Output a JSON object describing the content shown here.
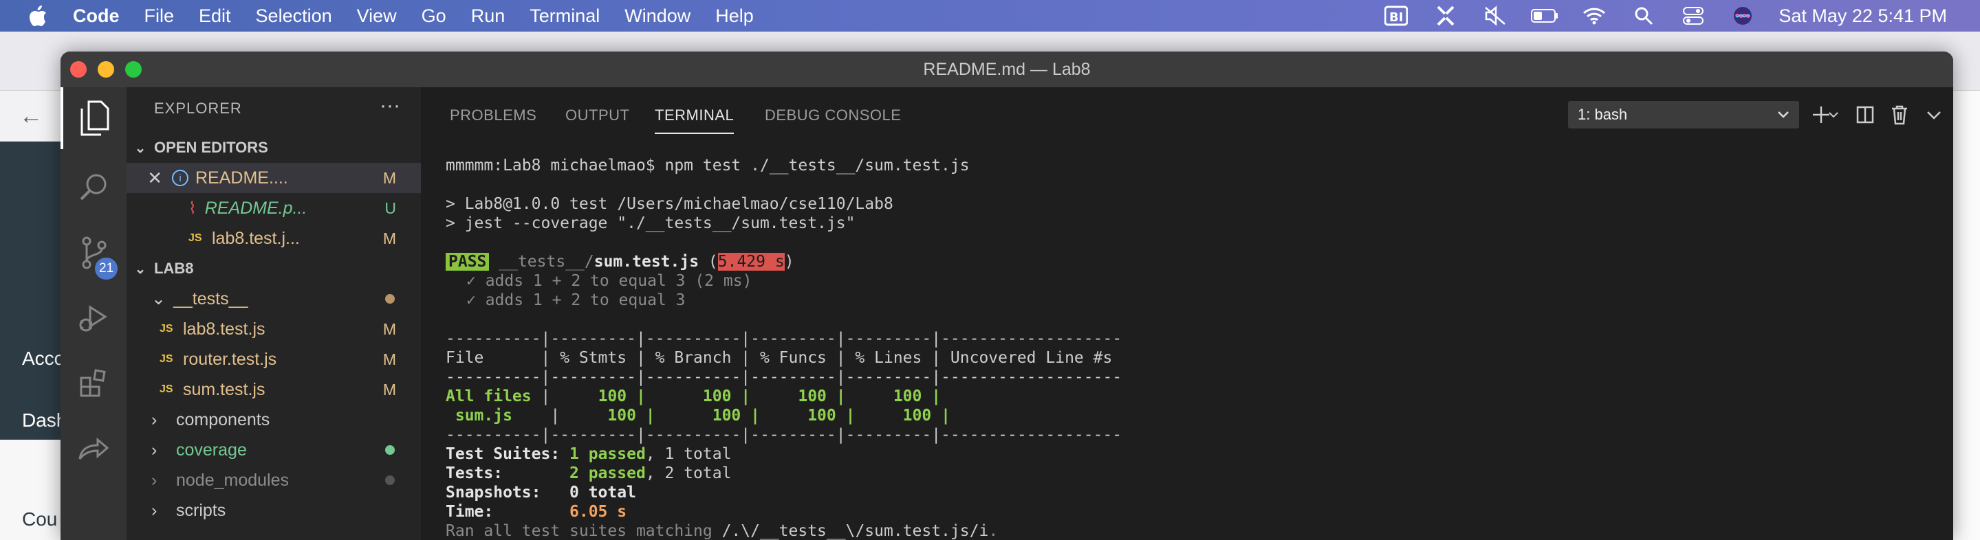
{
  "menubar": {
    "app_name": "Code",
    "items": [
      "File",
      "Edit",
      "Selection",
      "View",
      "Go",
      "Run",
      "Terminal",
      "Window",
      "Help"
    ],
    "clock": "Sat May 22  5:41 PM"
  },
  "background_app": {
    "sidebar_labels": [
      "Acco",
      "Dashb",
      "Cou"
    ]
  },
  "window": {
    "title": "README.md — Lab8"
  },
  "activity_bar": {
    "scm_badge": "21"
  },
  "explorer": {
    "header": "EXPLORER",
    "more": "···",
    "open_editors_label": "OPEN EDITORS",
    "open_editors": [
      {
        "name": "README....",
        "status": "M"
      },
      {
        "name": "README.p...",
        "status": "U"
      },
      {
        "name": "lab8.test.j...",
        "status": "M"
      }
    ],
    "workspace_label": "LAB8",
    "tree": [
      {
        "name": "__tests__"
      },
      {
        "name": "lab8.test.js",
        "status": "M"
      },
      {
        "name": "router.test.js",
        "status": "M"
      },
      {
        "name": "sum.test.js",
        "status": "M"
      },
      {
        "name": "components"
      },
      {
        "name": "coverage"
      },
      {
        "name": "node_modules"
      },
      {
        "name": "scripts"
      }
    ],
    "js_tag": "JS"
  },
  "panel": {
    "tabs": [
      "PROBLEMS",
      "OUTPUT",
      "TERMINAL",
      "DEBUG CONSOLE"
    ],
    "active_tab": "TERMINAL",
    "terminal_select": "1: bash"
  },
  "terminal": {
    "prompt": "mmmmm:Lab8 michaelmao$ npm test ./__tests__/sum.test.js",
    "npm_line1": "> Lab8@1.0.0 test /Users/michaelmao/cse110/Lab8",
    "npm_line2": "> jest --coverage \"./__tests__/sum.test.js\"",
    "pass": "PASS",
    "test_path_dir": "__tests__/",
    "test_path_file": "sum.test.js",
    "test_time": "5.429 s",
    "test1": "✓ adds 1 + 2 to equal 3 (2 ms)",
    "test2": "✓ adds 1 + 2 to equal 3",
    "table_rule": "----------|---------|----------|---------|---------|-------------------",
    "table_header": "File      | % Stmts | % Branch | % Funcs | % Lines | Uncovered Line #s ",
    "row_all_name": "All files",
    "row_all_vals": "     100 |      100 |     100 |     100 |",
    "row_sum_name": " sum.js",
    "row_sum_vals": "     100 |      100 |     100 |     100 |",
    "suites_label": "Test Suites: ",
    "suites_passed": "1 passed",
    "suites_total": ", 1 total",
    "tests_label": "Tests:       ",
    "tests_passed": "2 passed",
    "tests_total": ", 2 total",
    "snapshots": "Snapshots:   0 total",
    "time_label": "Time:        ",
    "time_value": "6.05 s",
    "ran_prefix": "Ran all test suites matching ",
    "ran_pattern": "/.\\/__tests__\\/sum.test.js/i",
    "ran_suffix": "."
  },
  "colors": {
    "accent": "#4d78cc",
    "modified": "#e2c08d",
    "untracked": "#73c991",
    "pass_green": "#8ac43f",
    "time_red": "#d9534f"
  }
}
